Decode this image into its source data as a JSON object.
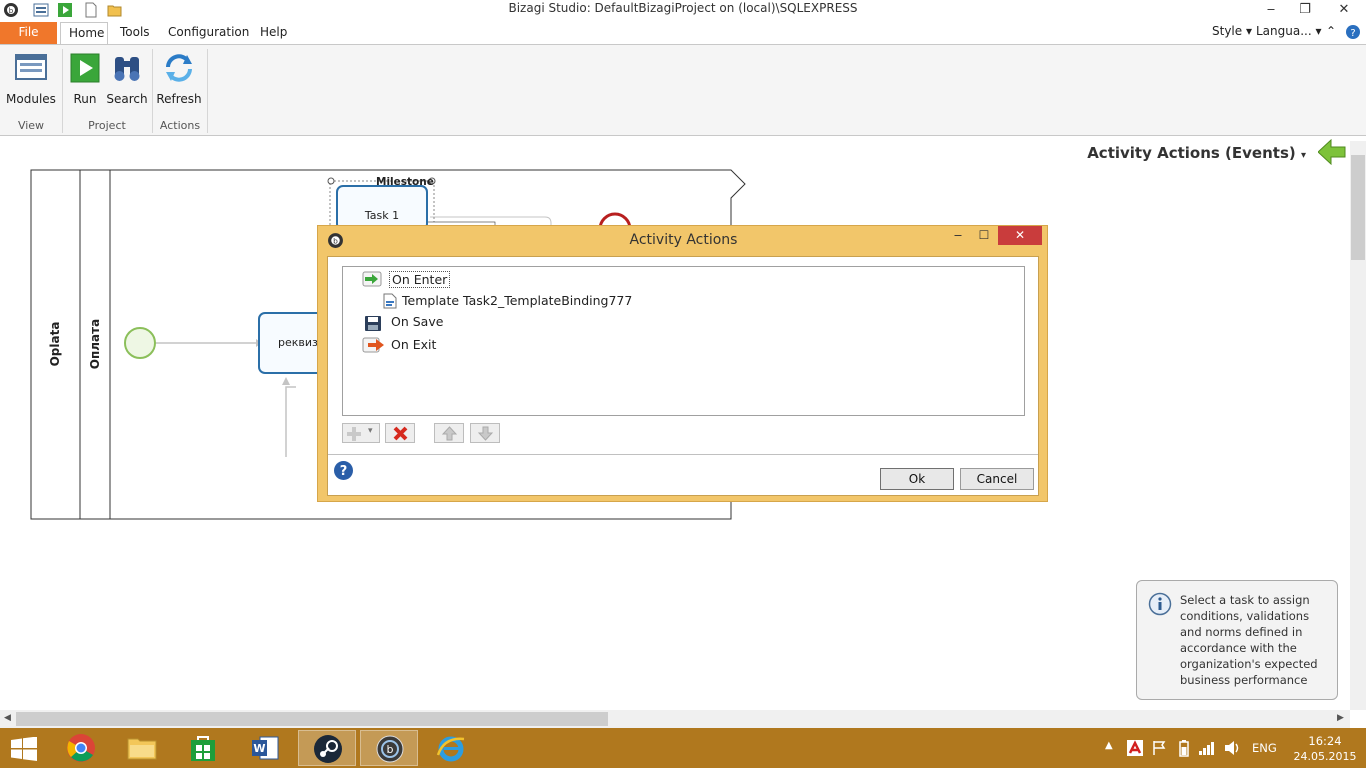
{
  "window": {
    "title": "Bizagi Studio: DefaultBizagiProject on (local)\\SQLEXPRESS",
    "minimize": "‒",
    "restore": "❐",
    "close": "✕"
  },
  "ribbon_tabs": [
    {
      "label": "File"
    },
    {
      "label": "Home"
    },
    {
      "label": "Tools"
    },
    {
      "label": "Configuration"
    },
    {
      "label": "Help"
    }
  ],
  "right_menu": {
    "style": "Style",
    "language": "Langua..."
  },
  "ribbon": {
    "buttons": [
      {
        "label": "Modules"
      },
      {
        "label": "Run"
      },
      {
        "label": "Search"
      },
      {
        "label": "Refresh"
      }
    ],
    "groups": [
      "View",
      "Project",
      "Actions"
    ]
  },
  "canvas": {
    "panel_title": "Activity Actions (Events)",
    "pool_label": "Oplata",
    "lane_label": "Оплата",
    "milestone_label": "Milestone",
    "task1_label": "Task 1",
    "task2_label": "реквизи"
  },
  "info": {
    "text": "Select a task to assign conditions, validations and norms defined in accordance with the organization's expected business performance"
  },
  "dialog": {
    "title": "Activity Actions",
    "tree": [
      {
        "label": "On Enter",
        "icon": "enter-arrow-icon"
      },
      {
        "label": "Template Task2_TemplateBinding777",
        "icon": "template-doc-icon"
      },
      {
        "label": "On Save",
        "icon": "floppy-disk-icon"
      },
      {
        "label": "On Exit",
        "icon": "exit-arrow-icon"
      }
    ],
    "ok": "Ok",
    "cancel": "Cancel"
  },
  "taskbar": {
    "lang": "ENG",
    "time": "16:24",
    "date": "24.05.2015"
  },
  "colors": {
    "file_tab": "#f0772b",
    "dialog_frame": "#f2c66a",
    "taskbar": "#b0781e",
    "task_border": "#2b6fa8"
  }
}
